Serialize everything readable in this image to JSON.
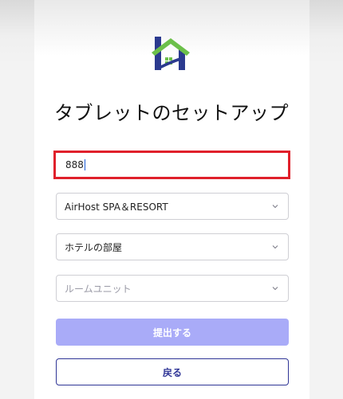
{
  "page": {
    "title": "タブレットのセットアップ"
  },
  "form": {
    "code_value": "888",
    "hotel_select": "AirHost SPA＆RESORT",
    "room_type_select": "ホテルの部屋",
    "room_unit_placeholder": "ルームユニット"
  },
  "actions": {
    "submit_label": "提出する",
    "back_label": "戻る"
  },
  "icons": {
    "logo": "house-h-logo-icon",
    "dropdown": "chevron-down-icon"
  },
  "colors": {
    "logo_blue": "#2b3a8f",
    "logo_green": "#6cc04a",
    "highlight_red": "#e0202b",
    "submit_disabled": "#a9abf8",
    "back_border": "#2f3596"
  }
}
